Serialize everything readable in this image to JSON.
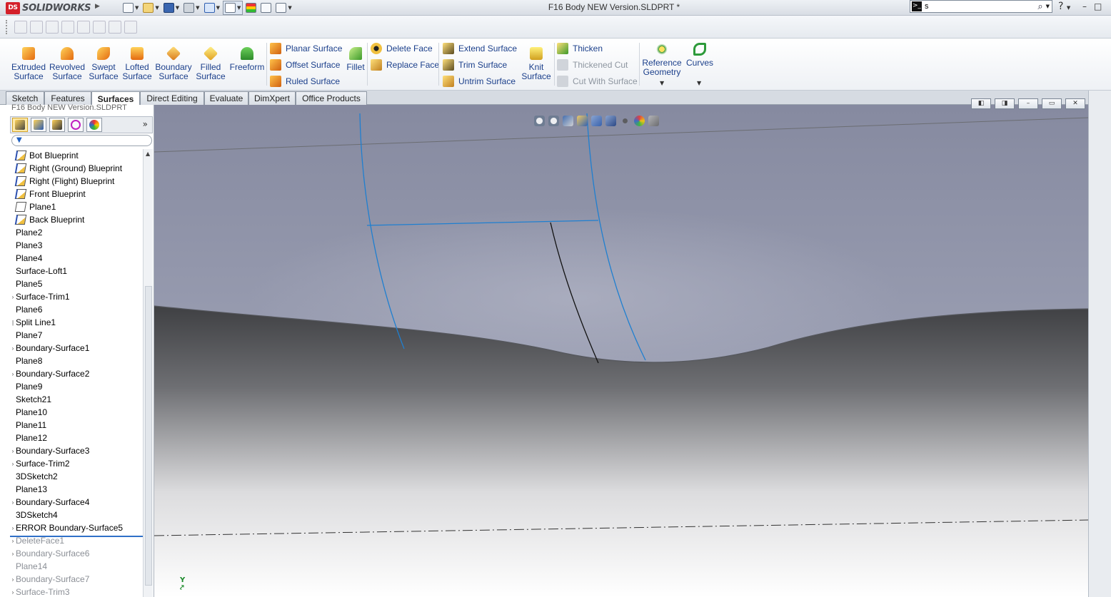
{
  "app": {
    "name": "SOLIDWORKS",
    "document_title": "F16 Body NEW Version.SLDPRT *"
  },
  "search": {
    "value": "s"
  },
  "help": "?",
  "window_controls": [
    "–",
    "□"
  ],
  "command_manager": {
    "big_buttons": [
      {
        "line1": "Extruded",
        "line2": "Surface"
      },
      {
        "line1": "Revolved",
        "line2": "Surface"
      },
      {
        "line1": "Swept",
        "line2": "Surface"
      },
      {
        "line1": "Lofted",
        "line2": "Surface"
      },
      {
        "line1": "Boundary",
        "line2": "Surface"
      },
      {
        "line1": "Filled",
        "line2": "Surface"
      },
      {
        "line1": "Freeform",
        "line2": ""
      }
    ],
    "surface_group": [
      "Planar Surface",
      "Offset Surface",
      "Ruled Surface"
    ],
    "fillet": "Fillet",
    "face_group": [
      "Delete Face",
      "Replace Face"
    ],
    "edit_group": [
      "Extend Surface",
      "Trim Surface",
      "Untrim Surface"
    ],
    "knit": {
      "line1": "Knit",
      "line2": "Surface"
    },
    "thicken_group": [
      "Thicken",
      "Thickened Cut",
      "Cut With Surface"
    ],
    "reference": {
      "line1": "Reference",
      "line2": "Geometry"
    },
    "curves": "Curves"
  },
  "tabs": [
    "Sketch",
    "Features",
    "Surfaces",
    "Direct Editing",
    "Evaluate",
    "DimXpert",
    "Office Products"
  ],
  "active_tab": "Surfaces",
  "feature_manager": {
    "doc_name": "F16 Body NEW Version.SLDPRT",
    "expand": "»",
    "tree": [
      {
        "label": "Bot Blueprint",
        "icon": "sketch-icon",
        "exp": ""
      },
      {
        "label": "Right (Ground) Blueprint",
        "icon": "sketch-icon",
        "exp": ""
      },
      {
        "label": "Right (Flight) Blueprint",
        "icon": "sketch-icon",
        "exp": ""
      },
      {
        "label": "Front Blueprint",
        "icon": "sketch-icon",
        "exp": ""
      },
      {
        "label": "Plane1",
        "icon": "plane-icon",
        "exp": ""
      },
      {
        "label": "Back Blueprint",
        "icon": "sketch-icon",
        "exp": ""
      },
      {
        "label": "Plane2",
        "icon": "",
        "exp": ""
      },
      {
        "label": "Plane3",
        "icon": "",
        "exp": ""
      },
      {
        "label": "Plane4",
        "icon": "",
        "exp": ""
      },
      {
        "label": "Surface-Loft1",
        "icon": "",
        "exp": ""
      },
      {
        "label": "Plane5",
        "icon": "",
        "exp": ""
      },
      {
        "label": "Surface-Trim1",
        "icon": "",
        "exp": "›"
      },
      {
        "label": "Plane6",
        "icon": "",
        "exp": ""
      },
      {
        "label": "Split Line1",
        "icon": "",
        "exp": "|"
      },
      {
        "label": "Plane7",
        "icon": "",
        "exp": ""
      },
      {
        "label": "Boundary-Surface1",
        "icon": "",
        "exp": "›"
      },
      {
        "label": "Plane8",
        "icon": "",
        "exp": ""
      },
      {
        "label": "Boundary-Surface2",
        "icon": "",
        "exp": "›"
      },
      {
        "label": "Plane9",
        "icon": "",
        "exp": ""
      },
      {
        "label": "Sketch21",
        "icon": "",
        "exp": ""
      },
      {
        "label": "Plane10",
        "icon": "",
        "exp": ""
      },
      {
        "label": "Plane11",
        "icon": "",
        "exp": ""
      },
      {
        "label": "Plane12",
        "icon": "",
        "exp": ""
      },
      {
        "label": "Boundary-Surface3",
        "icon": "",
        "exp": "›"
      },
      {
        "label": "Surface-Trim2",
        "icon": "",
        "exp": "›"
      },
      {
        "label": "3DSketch2",
        "icon": "",
        "exp": ""
      },
      {
        "label": "Plane13",
        "icon": "",
        "exp": ""
      },
      {
        "label": "Boundary-Surface4",
        "icon": "",
        "exp": "›"
      },
      {
        "label": "3DSketch4",
        "icon": "",
        "exp": ""
      },
      {
        "label": "ERROR Boundary-Surface5",
        "icon": "",
        "exp": "›"
      },
      {
        "label": "DeleteFace1",
        "icon": "",
        "exp": "›",
        "suppressed": true
      },
      {
        "label": "Boundary-Surface6",
        "icon": "",
        "exp": "›",
        "suppressed": true
      },
      {
        "label": "Plane14",
        "icon": "",
        "exp": "",
        "suppressed": true
      },
      {
        "label": "Boundary-Surface7",
        "icon": "",
        "exp": "›",
        "suppressed": true
      },
      {
        "label": "Surface-Trim3",
        "icon": "",
        "exp": "›",
        "suppressed": true
      }
    ]
  },
  "triad_label": "Y",
  "colors": {
    "accent": "#1b3f8b",
    "rollback": "#3070c8",
    "surface_edge": "#1f7fd0"
  }
}
